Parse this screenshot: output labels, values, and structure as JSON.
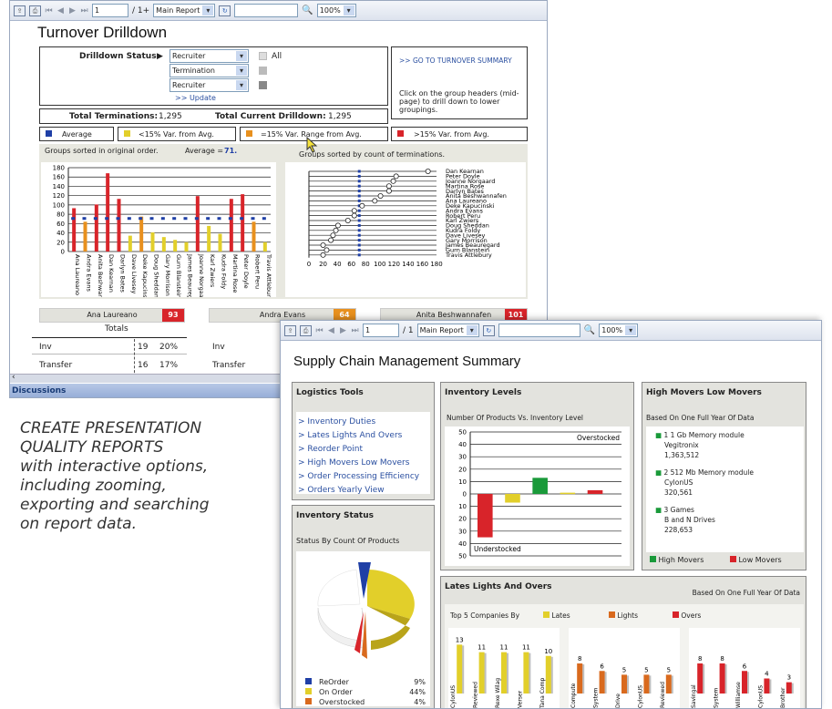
{
  "report1": {
    "toolbar": {
      "page": "1",
      "page_total": "/ 1+",
      "report_select": "Main Report",
      "zoom": "100%"
    },
    "title": "Turnover Drilldown",
    "drill_label": "Drilldown Status:",
    "drill_selects": [
      "Recruiter",
      "Termination Type",
      "Recruiter"
    ],
    "all_label": "All",
    "update_link": ">> Update",
    "goto_link": ">> GO TO TURNOVER SUMMARY",
    "help_text": "Click on the group headers (mid-page) to drill down to lower groupings.",
    "total_term_label": "Total Terminations:",
    "total_term": "1,295",
    "total_drill_label": "Total Current Drilldown:",
    "total_drill": "1,295",
    "legend": [
      {
        "label": "Average",
        "color": "#1f3fa6"
      },
      {
        "label": "<15% Var. from Avg.",
        "color": "#e2cf2a"
      },
      {
        "label": "=15% Var. Range from Avg.",
        "color": "#e8901e"
      },
      {
        "label": ">15% Var. from Avg.",
        "color": "#d8242a"
      }
    ],
    "left_caption": "Groups sorted in original order.",
    "avg_label": "Average =",
    "avg_value": "71.",
    "right_caption": "Groups sorted by count of terminations.",
    "rows": [
      {
        "name": "Ana Laureano",
        "value": "93",
        "color": "#d8242a"
      },
      {
        "name": "Andra Evans",
        "value": "64",
        "color": "#e8901e"
      },
      {
        "name": "Anita Beshwannafen",
        "value": "101",
        "color": "#d8242a"
      }
    ],
    "totals_header": "Totals",
    "totals": [
      {
        "label": "Inv",
        "count": "19",
        "pct": "20%",
        "label2": "Inv"
      },
      {
        "label": "Transfer",
        "count": "16",
        "pct": "17%",
        "label2": "Transfer"
      }
    ],
    "status_bar": "Discussions"
  },
  "bar_chart": {
    "type": "bar",
    "categories": [
      "Ana Laureano",
      "Andra Evans",
      "Anita Beshwannafen",
      "Dan Kearnan",
      "Darlyn Bates",
      "Dave Livesey",
      "Deke Kapucinski",
      "Doug Sheddan",
      "Gary Morrison",
      "Gurn Blanstein",
      "James Beauregard",
      "Joanne Norgaard",
      "Karl Zwiers",
      "Kudra Foldy",
      "Martina Rose",
      "Peter Doyle",
      "Robert Peru",
      "Travis Attlebury"
    ],
    "values": [
      93,
      64,
      101,
      168,
      113,
      34,
      75,
      41,
      31,
      25,
      20,
      119,
      55,
      38,
      113,
      123,
      64,
      20
    ],
    "colors": [
      "#d8242a",
      "#e8901e",
      "#d8242a",
      "#d8242a",
      "#d8242a",
      "#e2cf2a",
      "#e8901e",
      "#e2cf2a",
      "#e2cf2a",
      "#e2cf2a",
      "#e2cf2a",
      "#d8242a",
      "#e2cf2a",
      "#e2cf2a",
      "#d8242a",
      "#d8242a",
      "#e8901e",
      "#e2cf2a"
    ],
    "average": 71,
    "ylim": [
      0,
      180
    ],
    "yticks": [
      "180",
      "160",
      "140",
      "120",
      "100",
      "80",
      "60",
      "40",
      "20",
      "0"
    ]
  },
  "dot_chart": {
    "type": "scatter",
    "names": [
      "Dan Kearnan",
      "Peter Doyle",
      "Joanne Norgaard",
      "Martina Rose",
      "Darlyn Bates",
      "Anita Beshwannafen",
      "Ana Laureano",
      "Deke Kapucinski",
      "Andra Evans",
      "Robert Peru",
      "Karl Zwiers",
      "Doug Sheddan",
      "Kudra Foldy",
      "Dave Livesey",
      "Gary Morrison",
      "James Beauregard",
      "Gurn Blanstein",
      "Travis Attlebury"
    ],
    "values": [
      168,
      123,
      119,
      113,
      113,
      101,
      93,
      75,
      64,
      64,
      55,
      41,
      38,
      34,
      31,
      20,
      25,
      20
    ],
    "average": 71,
    "xlim": [
      0,
      180
    ],
    "xticks": [
      "0",
      "20",
      "40",
      "60",
      "80",
      "100",
      "120",
      "140",
      "160",
      "180"
    ]
  },
  "report2": {
    "toolbar": {
      "page": "1",
      "page_total": "/ 1",
      "report_select": "Main Report",
      "zoom": "100%"
    },
    "title": "Supply Chain Management Summary",
    "logistics": {
      "title": "Logistics Tools",
      "links": [
        "> Inventory Duties",
        "> Lates Lights And Overs",
        "> Reorder Point",
        "> High Movers Low Movers",
        "> Order Processing Efficiency",
        "> Orders Yearly View"
      ]
    },
    "inv_status": {
      "title": "Inventory Status",
      "subtitle": "Status By Count Of Products",
      "legend": [
        {
          "label": "ReOrder",
          "pct": "9%",
          "color": "#1f3fa6"
        },
        {
          "label": "On Order",
          "pct": "44%",
          "color": "#e2cf2a"
        },
        {
          "label": "Overstocked",
          "pct": "4%",
          "color": "#d96a1e"
        }
      ]
    },
    "inv_levels": {
      "title": "Inventory Levels",
      "subtitle": "Number Of Products Vs. Inventory Level",
      "over": "Overstocked",
      "under": "Understocked",
      "yticks": [
        "50",
        "40",
        "30",
        "20",
        "10",
        "0",
        "10",
        "20",
        "30",
        "40",
        "50"
      ]
    },
    "movers": {
      "title": "High Movers Low Movers",
      "subtitle": "Based On One Full Year Of Data",
      "items": [
        {
          "name": "1 1 Gb Memory module",
          "company": "Vegitronix",
          "value": "1,363,512"
        },
        {
          "name": "2 512 Mb Memory module",
          "company": "CylonUS",
          "value": "320,561"
        },
        {
          "name": "3 Games",
          "company": "B and N Drives",
          "value": "228,653"
        }
      ],
      "legend_high": "High Movers",
      "legend_low": "Low Movers"
    },
    "lates": {
      "title": "Lates Lights And Overs",
      "subtitle": "Based On One Full Year Of Data",
      "top5": "Top 5 Companies By",
      "legend": [
        {
          "label": "Lates",
          "color": "#e2cf2a"
        },
        {
          "label": "Lights",
          "color": "#d96a1e"
        },
        {
          "label": "Overs",
          "color": "#d8242a"
        }
      ]
    }
  },
  "inv_chart": {
    "type": "bar",
    "values": [
      -35,
      -7,
      13,
      1,
      3
    ],
    "colors": [
      "#d8242a",
      "#e2cf2a",
      "#1a9a3a",
      "#e2cf2a",
      "#d8242a"
    ],
    "ylim": [
      -50,
      50
    ]
  },
  "lates_chart": [
    {
      "type": "bar",
      "color": "#e2cf2a",
      "values": [
        13,
        11,
        11,
        11,
        10
      ],
      "labels": [
        "CylonUS",
        "Reviewed",
        "Rexe Wilag",
        "Verser",
        "Tana Comp"
      ]
    },
    {
      "type": "bar",
      "color": "#d96a1e",
      "values": [
        8,
        6,
        5,
        5,
        5
      ],
      "labels": [
        "Compute",
        "System",
        "Drive",
        "CylonUS",
        "Reviewed"
      ]
    },
    {
      "type": "bar",
      "color": "#d8242a",
      "values": [
        8,
        8,
        6,
        4,
        3
      ],
      "labels": [
        "Savingal",
        "System",
        "Williamse",
        "CylonUS",
        "Brother"
      ]
    }
  ],
  "promo": [
    "CREATE PRESENTATION",
    "QUALITY REPORTS",
    "with interactive options,",
    "including zooming,",
    "exporting and searching",
    "on report data."
  ]
}
